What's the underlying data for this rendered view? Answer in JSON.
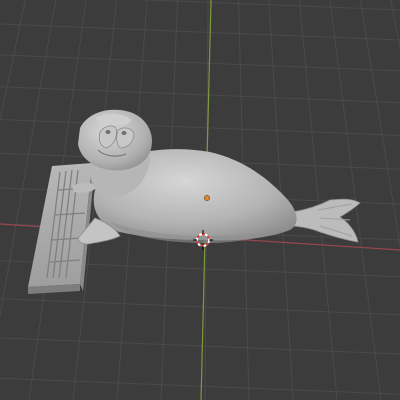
{
  "viewport": {
    "mode": "3d-viewport",
    "shading": "solid",
    "colors": {
      "background": "#3c3c3c",
      "grid_line": "#4a4a4a",
      "x_axis": "#9a4650",
      "y_axis": "#7f9a3c",
      "model": "#b4b4b4",
      "origin": "#e08a2a",
      "cursor_red": "#d94040",
      "cursor_white": "#ffffff"
    }
  },
  "scene": {
    "object": "seal-sculpt",
    "base": "keyboard-plinth",
    "origin_point_visible": true,
    "cursor_3d_visible": true
  }
}
